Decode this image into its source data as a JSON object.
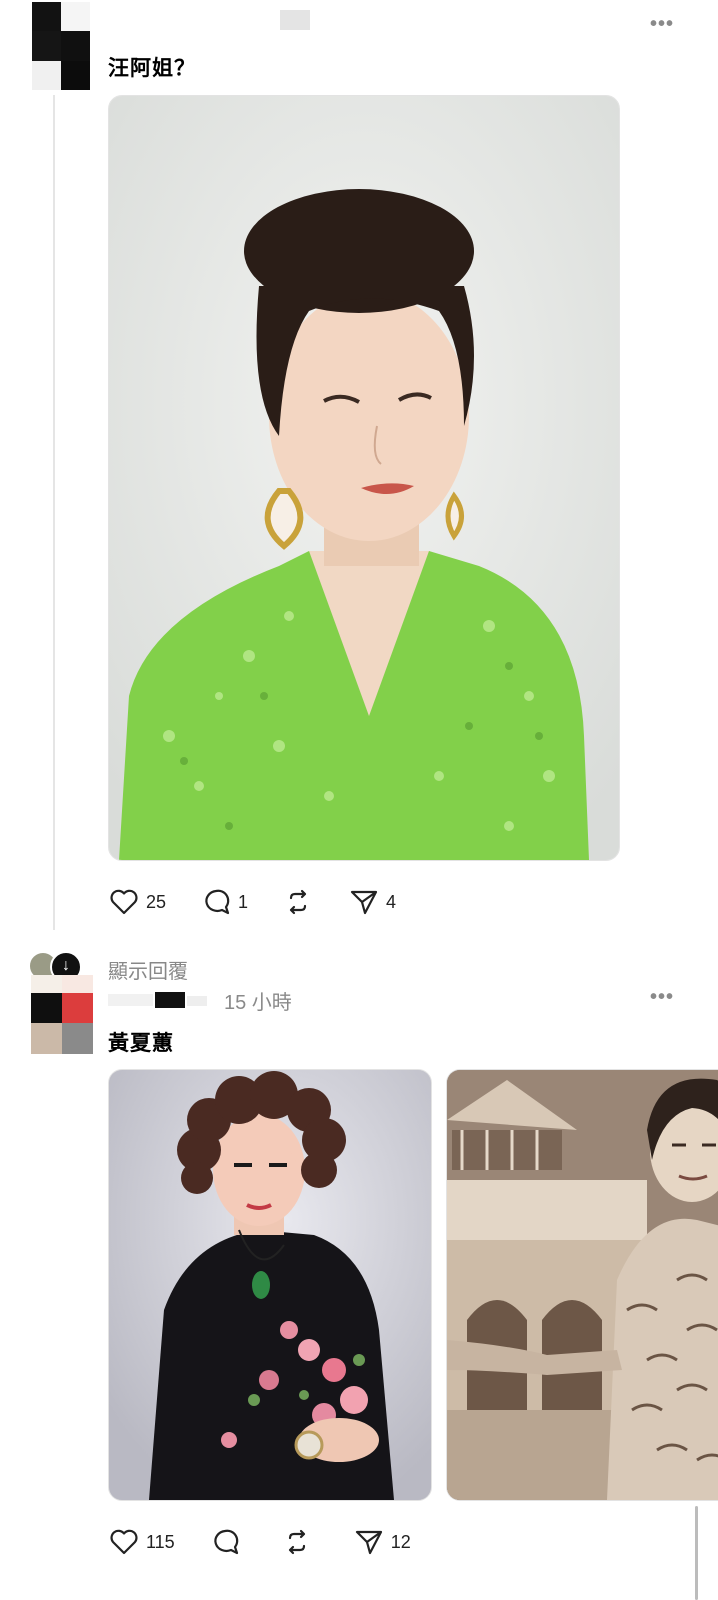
{
  "post1": {
    "text": "汪阿姐？",
    "more": "•••",
    "likes": "25",
    "comments": "1",
    "shares": "4"
  },
  "replies": {
    "show_replies": "顯示回覆"
  },
  "post2": {
    "time": "15 小時",
    "more": "•••",
    "text": "黃夏蕙",
    "likes": "115",
    "shares": "12"
  },
  "icons": {
    "like": "heart-icon",
    "comment": "comment-icon",
    "repost": "repost-icon",
    "share": "share-icon",
    "more": "more-icon",
    "follow": "follow-icon"
  },
  "colors": {
    "muted": "#8a8a8a",
    "divider": "#e5e5e5"
  }
}
